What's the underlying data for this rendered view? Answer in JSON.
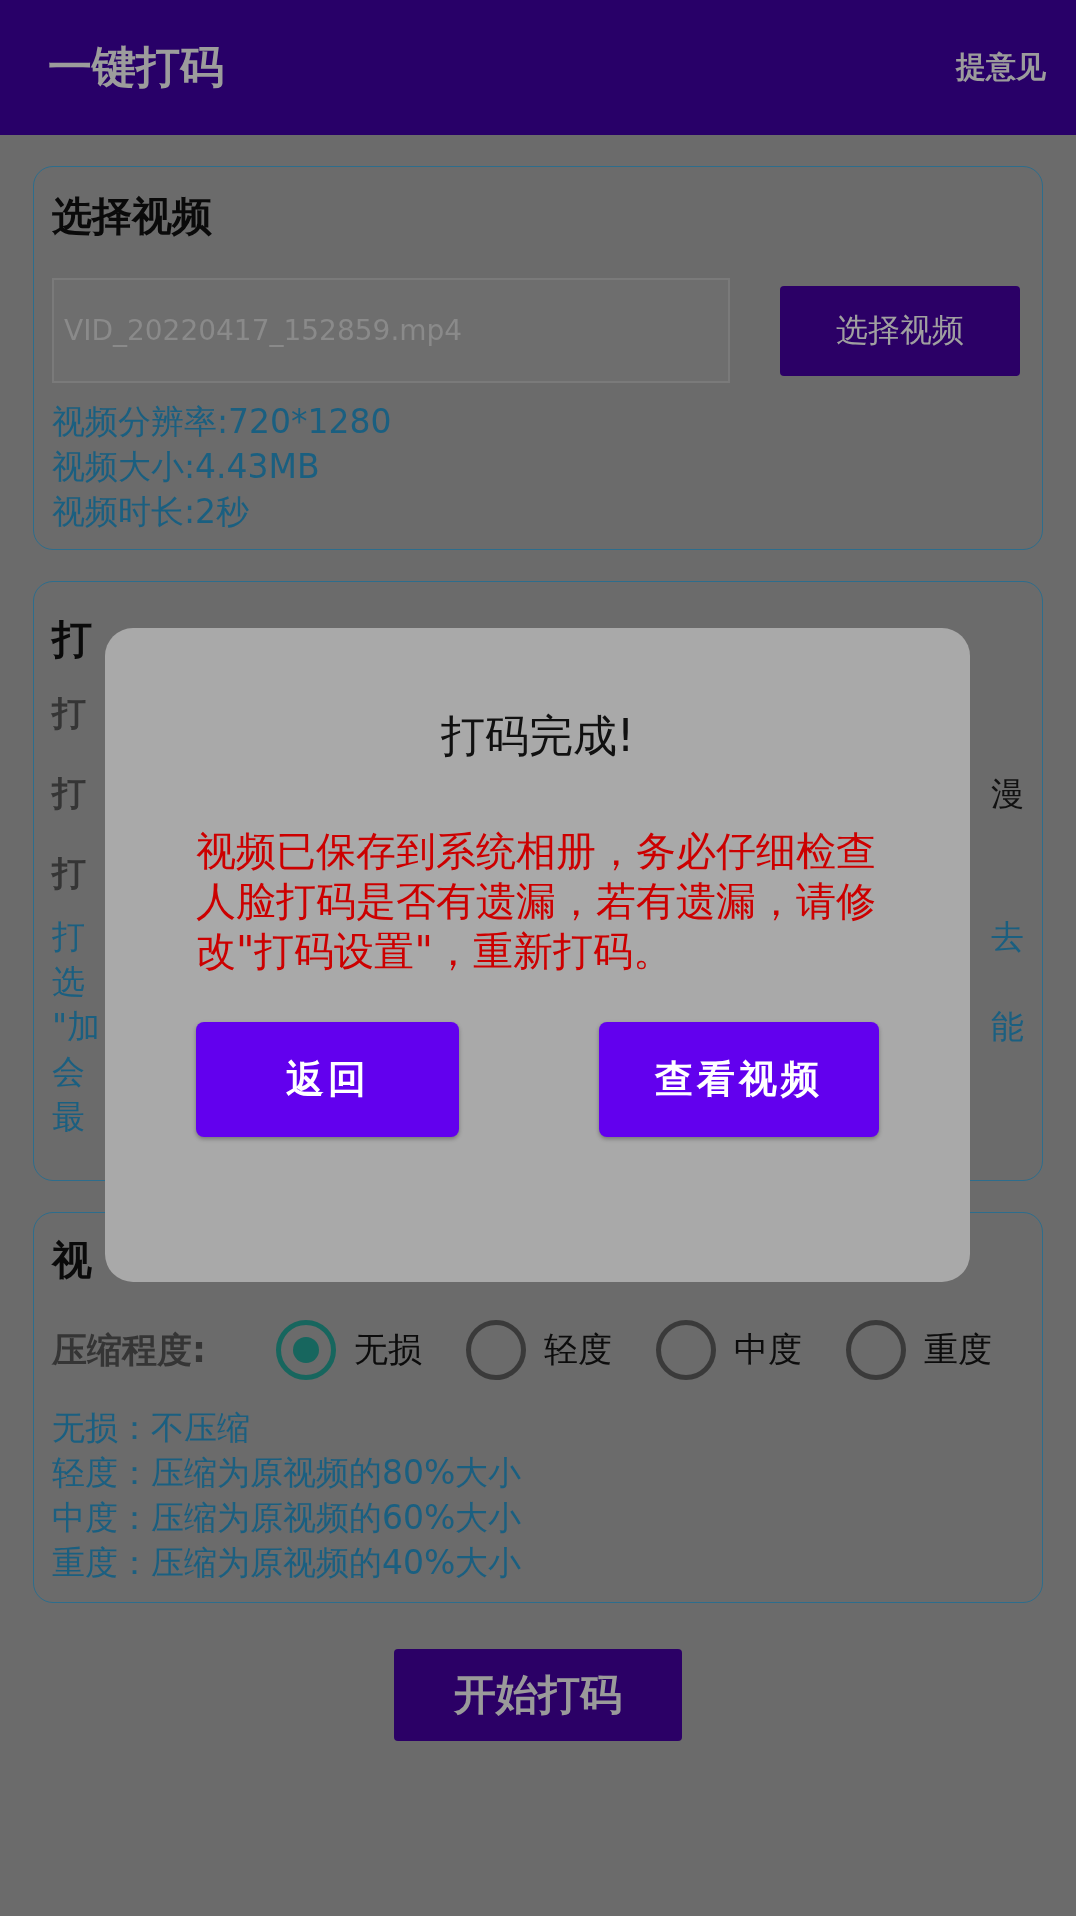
{
  "app_bar": {
    "title": "一键打码",
    "action": "提意见"
  },
  "video_card": {
    "heading": "选择视频",
    "file_field": {
      "value": "VID_20220417_152859.mp4"
    },
    "choose_button": "选择视频",
    "info": [
      "视频分辨率:720*1280",
      "视频大小:4.43MB",
      "视频时长:2秒"
    ]
  },
  "settings_card": {
    "heading": "打",
    "rows": [
      {
        "label": "打"
      },
      {
        "label": "打",
        "trailing": "漫"
      },
      {
        "label": "打"
      }
    ],
    "note_lines": [
      {
        "left": "打",
        "right": "去"
      },
      {
        "left": "选"
      },
      {
        "left": "\"加",
        "right": "能"
      },
      {
        "left": "会"
      },
      {
        "left": "最"
      }
    ]
  },
  "compress_card": {
    "heading": "视",
    "label": "压缩程度:",
    "options": [
      {
        "label": "无损",
        "selected": true
      },
      {
        "label": "轻度",
        "selected": false
      },
      {
        "label": "中度",
        "selected": false
      },
      {
        "label": "重度",
        "selected": false
      }
    ],
    "notes": [
      "无损：不压缩",
      "轻度：压缩为原视频的80%大小",
      "中度：压缩为原视频的60%大小",
      "重度：压缩为原视频的40%大小"
    ]
  },
  "start_button": "开始打码",
  "dialog": {
    "title": "打码完成!",
    "message": "视频已保存到系统相册，务必仔细检查人脸打码是否有遗漏，若有遗漏，请修改\"打码设置\"，重新打码。",
    "buttons": [
      "返回",
      "查看视频"
    ]
  }
}
